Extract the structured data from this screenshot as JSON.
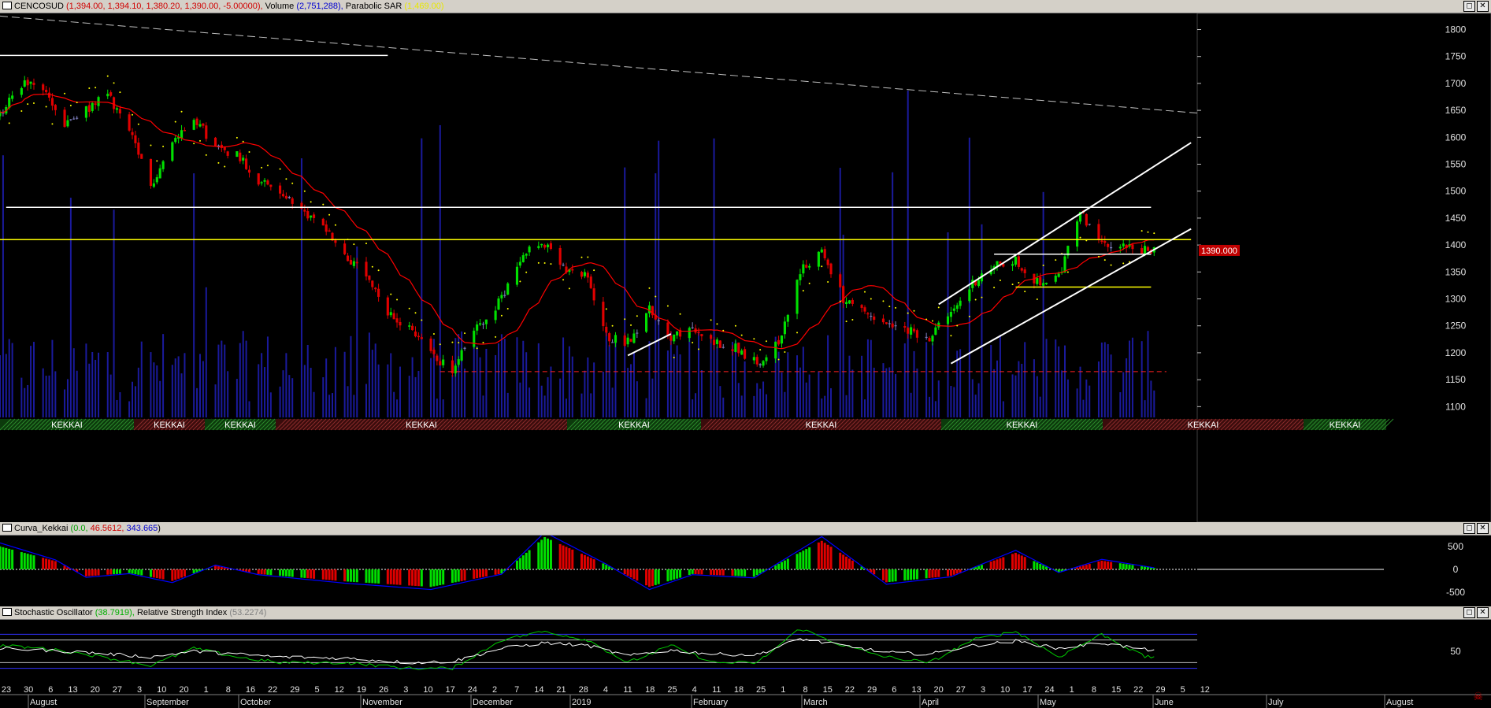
{
  "main_header": {
    "symbol": "CENCOSUD",
    "ohlc": "(1,394.00, 1,394.10, 1,380.20, 1,390.00, -5.00000),",
    "volume_label": "Volume",
    "volume_value": "(2,751,288),",
    "sar_label": "Parabolic SAR",
    "sar_value": "(1,469.00)"
  },
  "kekkai_header": {
    "name": "Curva_Kekkai",
    "v1": "0.0,",
    "v2": "46.5612,",
    "v3": "343.665",
    "close": ")"
  },
  "osc_header": {
    "stoch_label": "Stochastic Oscillator",
    "stoch_value": "(38.7919),",
    "rsi_label": "Relative Strength Index",
    "rsi_value": "(53.2274)"
  },
  "window_buttons": {
    "restore": "◻",
    "close": "✕"
  },
  "colors": {
    "bg": "#000000",
    "up": "#00e000",
    "down": "#e00000",
    "doji": "#8080c0",
    "volume": "#1a1a9c",
    "ma": "#ff0000",
    "sar": "#ffff00",
    "level_white": "#ffffff",
    "level_yellow": "#ffff00",
    "kekkai_band": "#0000ff",
    "stoch": "#00c800",
    "rsi": "#ffffff"
  },
  "price_tag": "1390.000",
  "kekkai_bar": [
    {
      "label": "KEKKAI",
      "state": "bull"
    },
    {
      "label": "KEKKAI",
      "state": "bear"
    },
    {
      "label": "KEKKAI",
      "state": "bull"
    },
    {
      "label": "KEKKAI",
      "state": "bear"
    },
    {
      "label": "KEKKAI",
      "state": "bull"
    },
    {
      "label": "KEKKAI",
      "state": "bear"
    },
    {
      "label": "KEKKAI",
      "state": "bull"
    },
    {
      "label": "KEKKAI",
      "state": "bear"
    },
    {
      "label": "KEKKAI",
      "state": "bull"
    }
  ],
  "date_axis": {
    "days": [
      "23",
      "30",
      "6",
      "13",
      "20",
      "27",
      "3",
      "10",
      "20",
      "1",
      "8",
      "16",
      "22",
      "29",
      "5",
      "12",
      "19",
      "26",
      "3",
      "10",
      "17",
      "24",
      "2",
      "7",
      "14",
      "21",
      "28",
      "4",
      "11",
      "18",
      "25",
      "4",
      "11",
      "18",
      "25",
      "1",
      "8",
      "15",
      "22",
      "29",
      "6",
      "13",
      "20",
      "27",
      "3",
      "10",
      "17",
      "24",
      "1",
      "8",
      "15",
      "22",
      "29",
      "5",
      "12"
    ],
    "months": [
      "August",
      "September",
      "October",
      "November",
      "December",
      "2019",
      "February",
      "March",
      "April",
      "May",
      "June",
      "July",
      "August"
    ]
  },
  "chart_data": [
    {
      "type": "candlestick",
      "title": "CENCOSUD",
      "ylim": [
        1080,
        1830
      ],
      "yticks": [
        1100,
        1150,
        1200,
        1250,
        1300,
        1350,
        1400,
        1450,
        1500,
        1550,
        1600,
        1650,
        1700,
        1750,
        1800
      ],
      "x_start": "2018-07-23",
      "x_end": "2019-08-16",
      "close_path": [
        [
          "2018-07-23",
          1640
        ],
        [
          "2018-07-30",
          1700
        ],
        [
          "2018-08-06",
          1690
        ],
        [
          "2018-08-13",
          1620
        ],
        [
          "2018-08-20",
          1650
        ],
        [
          "2018-08-27",
          1680
        ],
        [
          "2018-09-03",
          1610
        ],
        [
          "2018-09-10",
          1510
        ],
        [
          "2018-09-17",
          1590
        ],
        [
          "2018-09-24",
          1640
        ],
        [
          "2018-10-01",
          1580
        ],
        [
          "2018-10-08",
          1570
        ],
        [
          "2018-10-15",
          1520
        ],
        [
          "2018-10-22",
          1500
        ],
        [
          "2018-10-29",
          1460
        ],
        [
          "2018-11-05",
          1440
        ],
        [
          "2018-11-12",
          1380
        ],
        [
          "2018-11-19",
          1340
        ],
        [
          "2018-11-26",
          1270
        ],
        [
          "2018-12-03",
          1250
        ],
        [
          "2018-12-10",
          1200
        ],
        [
          "2018-12-17",
          1165
        ],
        [
          "2018-12-24",
          1240
        ],
        [
          "2019-01-02",
          1300
        ],
        [
          "2019-01-09",
          1390
        ],
        [
          "2019-01-16",
          1400
        ],
        [
          "2019-01-23",
          1350
        ],
        [
          "2019-01-30",
          1340
        ],
        [
          "2019-02-05",
          1230
        ],
        [
          "2019-02-12",
          1220
        ],
        [
          "2019-02-19",
          1280
        ],
        [
          "2019-02-26",
          1230
        ],
        [
          "2019-03-05",
          1240
        ],
        [
          "2019-03-12",
          1220
        ],
        [
          "2019-03-19",
          1210
        ],
        [
          "2019-03-26",
          1180
        ],
        [
          "2019-04-02",
          1220
        ],
        [
          "2019-04-09",
          1350
        ],
        [
          "2019-04-16",
          1390
        ],
        [
          "2019-04-23",
          1300
        ],
        [
          "2019-04-30",
          1270
        ],
        [
          "2019-05-07",
          1250
        ],
        [
          "2019-05-14",
          1240
        ],
        [
          "2019-05-21",
          1230
        ],
        [
          "2019-05-28",
          1270
        ],
        [
          "2019-06-04",
          1330
        ],
        [
          "2019-06-11",
          1360
        ],
        [
          "2019-06-18",
          1370
        ],
        [
          "2019-06-25",
          1330
        ],
        [
          "2019-07-02",
          1340
        ],
        [
          "2019-07-09",
          1460
        ],
        [
          "2019-07-16",
          1400
        ],
        [
          "2019-07-23",
          1400
        ],
        [
          "2019-07-30",
          1390
        ]
      ],
      "levels": [
        {
          "price": 1470,
          "color": "white",
          "from": "2018-07-25",
          "to": "2019-08-01"
        },
        {
          "price": 1410,
          "color": "yellow",
          "from": "2018-07-23",
          "to": "2019-08-14"
        },
        {
          "price": 1383,
          "color": "white",
          "from": "2019-06-11",
          "to": "2019-08-01"
        },
        {
          "price": 1322,
          "color": "yellow",
          "from": "2019-06-18",
          "to": "2019-08-01"
        },
        {
          "price": 1165,
          "color": "red-dashed",
          "from": "2018-12-13",
          "to": "2019-08-06"
        },
        {
          "price": 1752,
          "color": "white",
          "from": "2018-07-23",
          "to": "2018-11-26"
        }
      ],
      "trendlines": [
        {
          "from": [
            "2019-05-24",
            1290
          ],
          "to": [
            "2019-08-14",
            1590
          ]
        },
        {
          "from": [
            "2019-05-28",
            1180
          ],
          "to": [
            "2019-08-14",
            1430
          ]
        },
        {
          "from": [
            "2019-02-12",
            1195
          ],
          "to": [
            "2019-02-26",
            1235
          ]
        },
        {
          "from": [
            "2018-07-23",
            1825
          ],
          "to": [
            "2019-08-16",
            1645
          ],
          "style": "dashed"
        }
      ],
      "series": [
        {
          "name": "Volume",
          "value": "2,751,288"
        },
        {
          "name": "Parabolic SAR",
          "value": 1469.0
        }
      ]
    },
    {
      "type": "bar",
      "title": "Curva_Kekkai",
      "ylim": [
        -650,
        650
      ],
      "yticks": [
        -500,
        0,
        500
      ],
      "bar_amplitude_path": [
        [
          "2018-07-23",
          500
        ],
        [
          "2018-08-10",
          180
        ],
        [
          "2018-08-20",
          -150
        ],
        [
          "2018-09-03",
          -80
        ],
        [
          "2018-09-17",
          -250
        ],
        [
          "2018-10-01",
          80
        ],
        [
          "2018-10-15",
          -100
        ],
        [
          "2018-11-12",
          -260
        ],
        [
          "2018-12-10",
          -380
        ],
        [
          "2019-01-02",
          -90
        ],
        [
          "2019-01-16",
          700
        ],
        [
          "2019-02-05",
          100
        ],
        [
          "2019-02-19",
          -380
        ],
        [
          "2019-03-05",
          -100
        ],
        [
          "2019-03-25",
          -160
        ],
        [
          "2019-04-16",
          620
        ],
        [
          "2019-05-07",
          -280
        ],
        [
          "2019-05-28",
          -140
        ],
        [
          "2019-06-18",
          360
        ],
        [
          "2019-07-02",
          -60
        ],
        [
          "2019-07-16",
          190
        ],
        [
          "2019-08-02",
          30
        ]
      ]
    },
    {
      "type": "line",
      "title": "Stochastic Oscillator / Relative Strength Index",
      "ylim": [
        0,
        100
      ],
      "yticks": [
        50
      ],
      "series": [
        {
          "name": "Stochastic Oscillator",
          "last": 38.7919,
          "path": [
            [
              "2018-07-23",
              60
            ],
            [
              "2018-08-06",
              55
            ],
            [
              "2018-08-20",
              45
            ],
            [
              "2018-09-10",
              25
            ],
            [
              "2018-09-24",
              55
            ],
            [
              "2018-10-08",
              40
            ],
            [
              "2018-10-22",
              30
            ],
            [
              "2018-11-12",
              30
            ],
            [
              "2018-12-03",
              20
            ],
            [
              "2018-12-17",
              20
            ],
            [
              "2019-01-02",
              70
            ],
            [
              "2019-01-16",
              85
            ],
            [
              "2019-01-30",
              70
            ],
            [
              "2019-02-12",
              30
            ],
            [
              "2019-02-26",
              60
            ],
            [
              "2019-03-12",
              30
            ],
            [
              "2019-03-26",
              30
            ],
            [
              "2019-04-09",
              90
            ],
            [
              "2019-04-23",
              60
            ],
            [
              "2019-05-07",
              40
            ],
            [
              "2019-05-21",
              30
            ],
            [
              "2019-06-04",
              70
            ],
            [
              "2019-06-18",
              85
            ],
            [
              "2019-07-02",
              40
            ],
            [
              "2019-07-16",
              80
            ],
            [
              "2019-07-30",
              40
            ]
          ]
        },
        {
          "name": "Relative Strength Index",
          "last": 53.2274,
          "path": [
            [
              "2018-07-23",
              55
            ],
            [
              "2018-08-06",
              52
            ],
            [
              "2018-08-20",
              48
            ],
            [
              "2018-09-10",
              40
            ],
            [
              "2018-09-24",
              50
            ],
            [
              "2018-10-08",
              45
            ],
            [
              "2018-10-22",
              40
            ],
            [
              "2018-11-12",
              38
            ],
            [
              "2018-12-03",
              30
            ],
            [
              "2018-12-17",
              32
            ],
            [
              "2019-01-02",
              55
            ],
            [
              "2019-01-16",
              65
            ],
            [
              "2019-01-30",
              60
            ],
            [
              "2019-02-12",
              42
            ],
            [
              "2019-02-26",
              52
            ],
            [
              "2019-03-12",
              45
            ],
            [
              "2019-03-26",
              44
            ],
            [
              "2019-04-09",
              72
            ],
            [
              "2019-04-23",
              60
            ],
            [
              "2019-05-07",
              48
            ],
            [
              "2019-05-21",
              45
            ],
            [
              "2019-06-04",
              60
            ],
            [
              "2019-06-18",
              68
            ],
            [
              "2019-07-02",
              55
            ],
            [
              "2019-07-16",
              65
            ],
            [
              "2019-07-30",
              53
            ]
          ]
        }
      ],
      "levels": [
        80,
        70,
        30,
        20
      ]
    }
  ]
}
